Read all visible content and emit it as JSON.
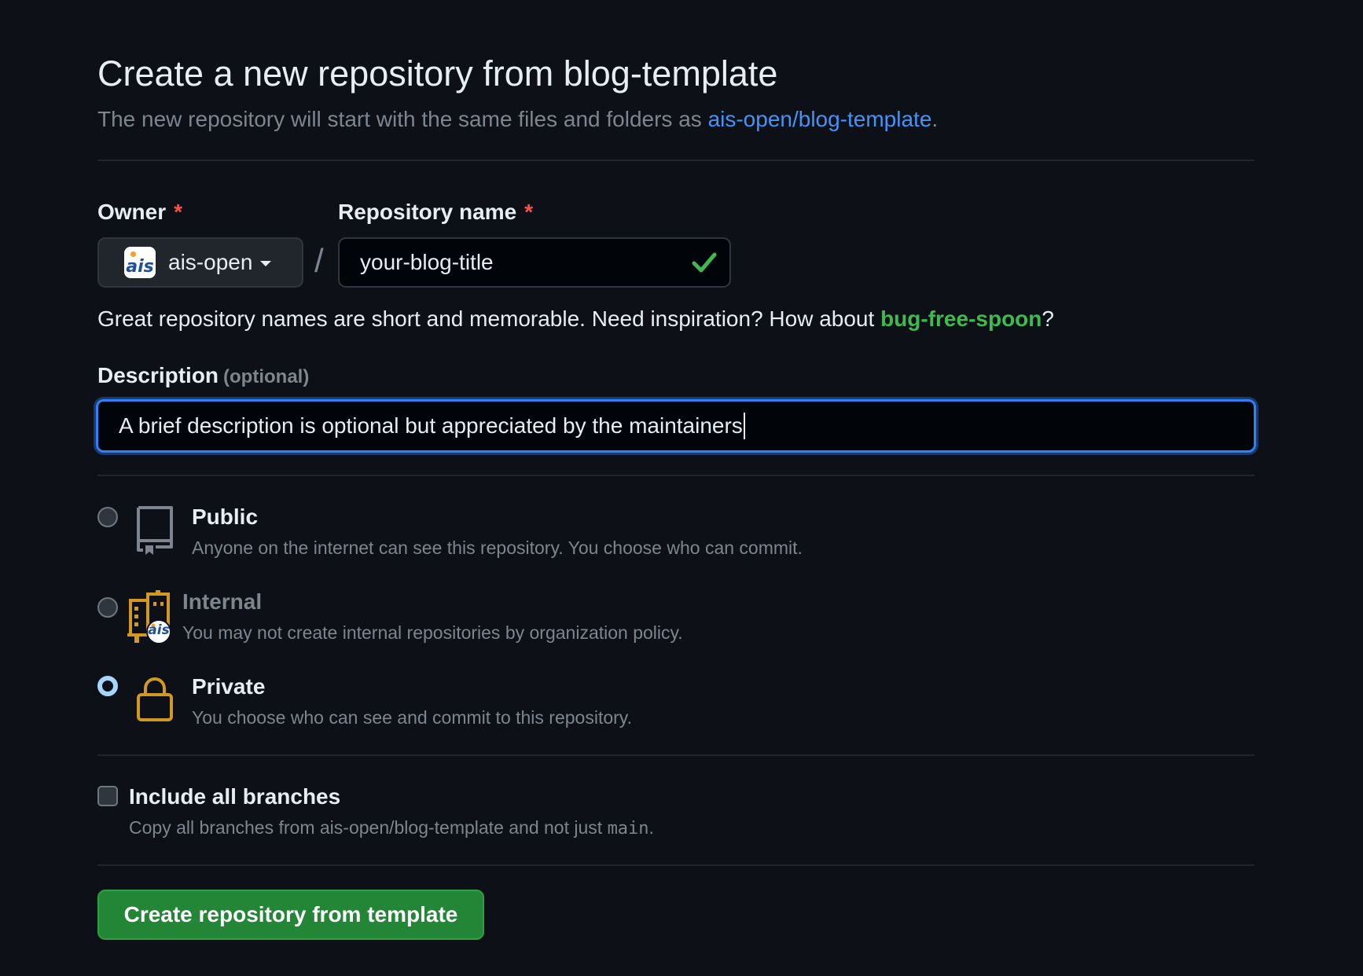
{
  "header": {
    "title": "Create a new repository from blog-template",
    "subtitle_prefix": "The new repository will start with the same files and folders as ",
    "template_link": "ais-open/blog-template",
    "subtitle_suffix": "."
  },
  "owner": {
    "label": "Owner",
    "required_mark": "*",
    "avatar_text": "ais",
    "value": "ais-open"
  },
  "repo_name": {
    "label": "Repository name",
    "required_mark": "*",
    "separator": "/",
    "value": "your-blog-title",
    "status_icon": "check-icon"
  },
  "hint": {
    "prefix": "Great repository names are short and memorable. Need inspiration? How about ",
    "suggestion": "bug-free-spoon",
    "suffix": "?"
  },
  "description": {
    "label": "Description",
    "optional": "(optional)",
    "value": "A brief description is optional but appreciated by the maintainers"
  },
  "visibility": {
    "selected": "Private",
    "options": [
      {
        "title": "Public",
        "desc": "Anyone on the internet can see this repository. You choose who can commit.",
        "icon": "repo-icon",
        "checked": false,
        "disabled": false
      },
      {
        "title": "Internal",
        "desc": "You may not create internal repositories by organization policy.",
        "icon": "organization-icon",
        "checked": false,
        "disabled": true
      },
      {
        "title": "Private",
        "desc": "You choose who can see and commit to this repository.",
        "icon": "lock-icon",
        "checked": true,
        "disabled": false
      }
    ]
  },
  "branches": {
    "label": "Include all branches",
    "desc_prefix": "Copy all branches from ais-open/blog-template and not just ",
    "desc_code": "main",
    "desc_suffix": ".",
    "checked": false
  },
  "submit": {
    "label": "Create repository from template"
  },
  "colors": {
    "background": "#0d1117",
    "accent": "#2f81f7",
    "success": "#3fb950",
    "danger": "#f85149",
    "icon_attention": "#d29922",
    "button_primary": "#238636"
  }
}
